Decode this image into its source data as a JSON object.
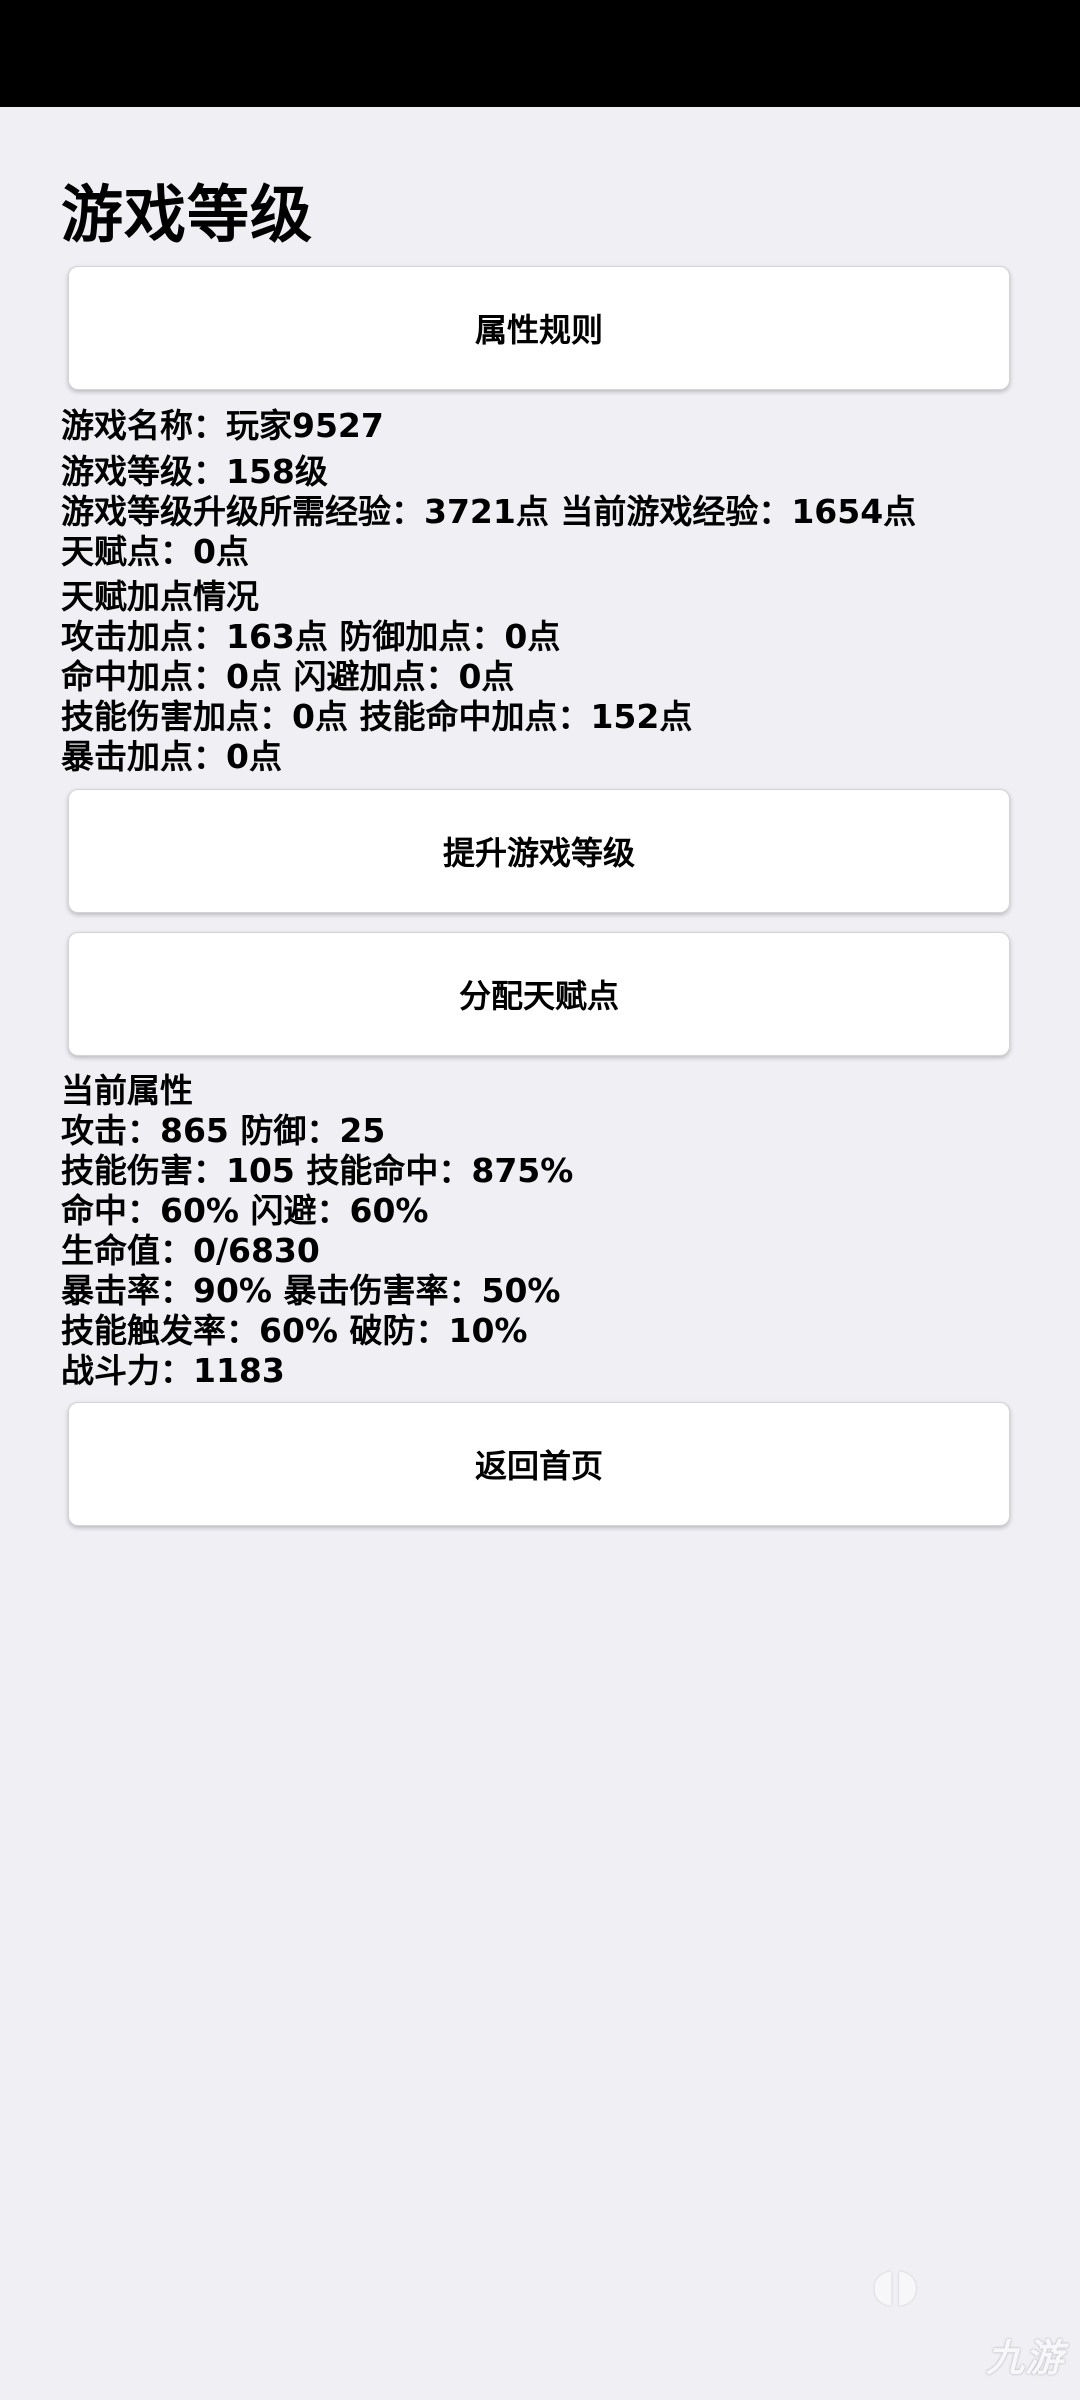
{
  "page": {
    "title": "游戏等级"
  },
  "buttons": {
    "attribute_rules": "属性规则",
    "level_up": "提升游戏等级",
    "allocate_talent": "分配天赋点",
    "back_home": "返回首页"
  },
  "info": [
    "游戏名称：玩家9527",
    "游戏等级：158级",
    "游戏等级升级所需经验：3721点 当前游戏经验：1654点",
    "天赋点：0点",
    "天赋加点情况",
    "攻击加点：163点 防御加点：0点",
    "命中加点：0点 闪避加点：0点",
    "技能伤害加点：0点 技能命中加点：152点",
    "暴击加点：0点"
  ],
  "attributes": [
    "当前属性",
    "攻击：865 防御：25",
    "技能伤害：105 技能命中：875%",
    "命中：60% 闪避：60%",
    "生命值：0/6830",
    "暴击率：90% 暴击伤害率：50%",
    "技能触发率：60% 破防：10%",
    "战斗力：1183"
  ],
  "watermark": {
    "text": "九游",
    "icon": "brand-logo-icon"
  },
  "colors": {
    "background": "#efeff4",
    "status_bar": "#000000",
    "button_bg": "#ffffff"
  }
}
